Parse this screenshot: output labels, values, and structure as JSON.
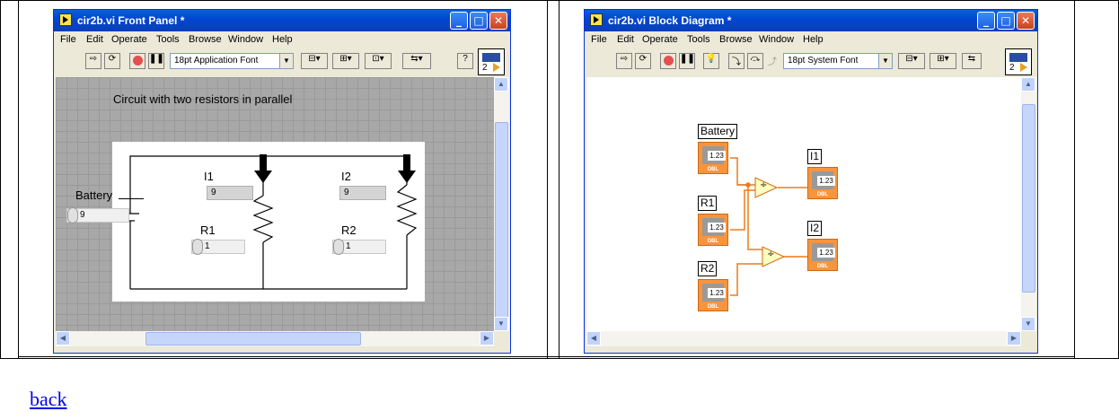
{
  "front_panel": {
    "title": "cir2b.vi Front Panel *",
    "menus": [
      "File",
      "Edit",
      "Operate",
      "Tools",
      "Browse",
      "Window",
      "Help"
    ],
    "font": "18pt Application Font",
    "heading": "Circuit with two resistors in parallel",
    "battery_label": "Battery",
    "battery_value": "9",
    "i1_label": "I1",
    "i1_value": "9",
    "i2_label": "I2",
    "i2_value": "9",
    "r1_label": "R1",
    "r1_value": "1",
    "r2_label": "R2",
    "r2_value": "1",
    "connector_num": "2"
  },
  "block_diagram": {
    "title": "cir2b.vi Block Diagram *",
    "menus": [
      "File",
      "Edit",
      "Operate",
      "Tools",
      "Browse",
      "Window",
      "Help"
    ],
    "font": "18pt System Font",
    "battery_label": "Battery",
    "r1_label": "R1",
    "r2_label": "R2",
    "i1_label": "I1",
    "i2_label": "I2",
    "terminal_value": "1.23",
    "terminal_type": "DBL",
    "divide_symbol": "÷",
    "connector_num": "2"
  },
  "back_link": "back"
}
